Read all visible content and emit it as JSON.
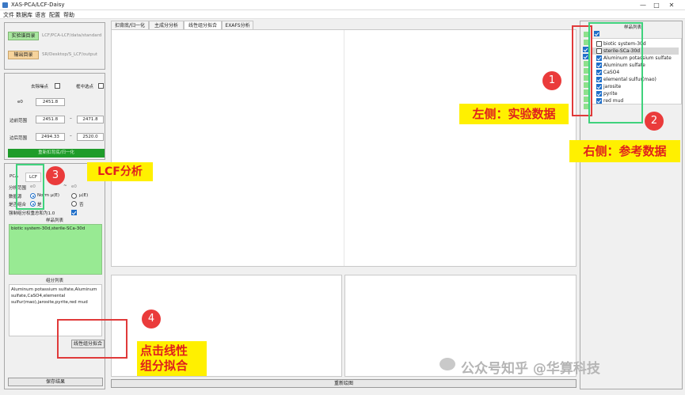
{
  "window": {
    "title": "XAS-PCA/LCF-Daisy",
    "controls": [
      "—",
      "□",
      "✕"
    ]
  },
  "menu": [
    "文件",
    "数据库",
    "语言",
    "配置",
    "帮助"
  ],
  "left_top": {
    "exp_button": "实验谱目录",
    "exp_path": "LCF/PCA-LCF/data/standard",
    "out_button": "输出目录",
    "out_path": "SR/Desktop/S_LCF/output"
  },
  "left_mid": {
    "remove_noise": "去除噪点",
    "middle_select": "框中选点",
    "e0_label": "e0",
    "e0_value": "2451.8",
    "pre_label": "边前范围",
    "pre_from": "2451.8",
    "pre_to": "2471.8",
    "post_label": "边后范围",
    "post_from": "2494.33",
    "post_to": "2520.0",
    "normalize_button": "重新扣背底/归一化"
  },
  "lcf_panel": {
    "tabs": [
      "PCA",
      "LCF"
    ],
    "fit_range_label": "分析范围",
    "fit_range_from": "e0",
    "fit_range_to": "e0",
    "data_type_label": "数据源",
    "data_type_opt1": "Norm μ(E)",
    "data_type_opt2": "μ(E)",
    "combos_label": "是否组合",
    "combos_opt1": "是",
    "combos_opt2": "否",
    "sum_to_one": "强制组分权重总和为1.0",
    "sample_list_title": "样品列表",
    "sample_list_text": "biotic system-30d,sterile-SCa-30d",
    "component_list_title": "组分列表",
    "component_list_text": "Aluminum potassium sulfate,Aluminum sulfate,CaSO4,elemental sulfur(mao),jarosite,pyrite,red mud",
    "fit_button": "线性组分拟合",
    "save_button": "保存结果"
  },
  "main_tabs": [
    "扣背底/归一化",
    "主成分分析",
    "线性组分拟合",
    "EXAFS分析"
  ],
  "active_tab_index": 2,
  "redraw_button": "重新绘图",
  "sample_panel": {
    "title": "样品列表",
    "items": [
      {
        "label": "biotic system-30d",
        "checked": false
      },
      {
        "label": "sterile-SCa-30d",
        "checked": false
      },
      {
        "label": "Aluminum potassium sulfate",
        "checked": true
      },
      {
        "label": "Aluminum sulfate",
        "checked": true
      },
      {
        "label": "CaSO4",
        "checked": true
      },
      {
        "label": "elemental sulfur(mao)",
        "checked": true
      },
      {
        "label": "jarosite",
        "checked": true
      },
      {
        "label": "pyrite",
        "checked": true
      },
      {
        "label": "red mud",
        "checked": true
      }
    ]
  },
  "annotations": {
    "n1": "1",
    "n2": "2",
    "n3": "3",
    "n4": "4",
    "left_label": "左侧：实验数据",
    "right_label": "右侧：参考数据",
    "lcf_label": "LCF分析",
    "click_label_1": "点击线性",
    "click_label_2": "组分拟合"
  },
  "watermark": "公众号知乎 @华算科技",
  "colors": {
    "annot_red": "#e03a3a",
    "annot_green": "#3fd27c",
    "label_bg": "#fff000",
    "label_fg": "#e0201d",
    "green_button": "#1e9c2a"
  }
}
